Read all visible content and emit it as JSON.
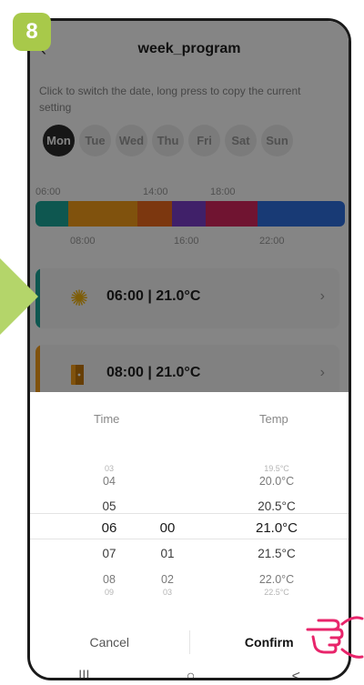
{
  "step": "8",
  "header": {
    "title": "week_program"
  },
  "hint": "Click to switch the date, long press to copy the current setting",
  "days": [
    "Mon",
    "Tue",
    "Wed",
    "Thu",
    "Fri",
    "Sat",
    "Sun"
  ],
  "active_day_index": 0,
  "timeline": {
    "top_labels": [
      "06:00",
      "14:00",
      "18:00"
    ],
    "bottom_labels": [
      "08:00",
      "16:00",
      "22:00"
    ],
    "segments": [
      {
        "color": "#1ba89a"
      },
      {
        "color": "#f59d1a"
      },
      {
        "color": "#ee6a1e"
      },
      {
        "color": "#7b3fc9"
      },
      {
        "color": "#d7285f"
      },
      {
        "color": "#2f6fe0"
      }
    ]
  },
  "cards": [
    {
      "text": "06:00  |  21.0°C",
      "icon": "sun-icon",
      "color": "#1ba89a"
    },
    {
      "text": "08:00  |  21.0°C",
      "icon": "door-icon",
      "color": "#f59d1a"
    }
  ],
  "picker": {
    "time_label": "Time",
    "temp_label": "Temp",
    "hours": [
      "03",
      "04",
      "05",
      "06",
      "07",
      "08",
      "09"
    ],
    "minutes": [
      "",
      "",
      "",
      "00",
      "01",
      "02",
      "03"
    ],
    "temps": [
      "19.5°C",
      "20.0°C",
      "20.5°C",
      "21.0°C",
      "21.5°C",
      "22.0°C",
      "22.5°C"
    ],
    "selected_index": 3
  },
  "buttons": {
    "cancel": "Cancel",
    "confirm": "Confirm"
  },
  "nav": {
    "recents": "|||",
    "home": "○",
    "back": "<"
  }
}
